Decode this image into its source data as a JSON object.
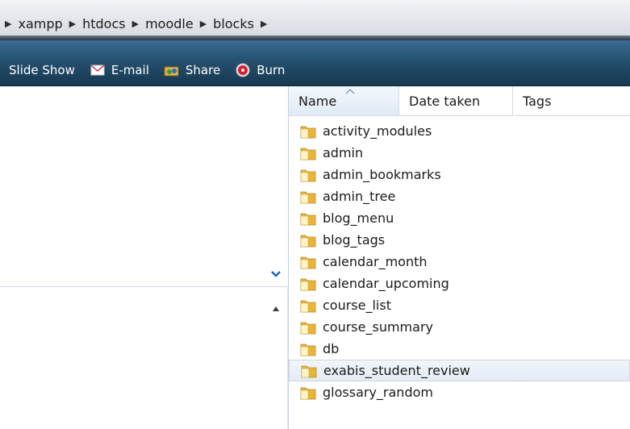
{
  "breadcrumb": {
    "items": [
      "xampp",
      "htdocs",
      "moodle",
      "blocks"
    ],
    "separator_glyph": "▶"
  },
  "toolbar": {
    "items": [
      {
        "label": "Slide Show",
        "icon": "none"
      },
      {
        "label": "E-mail",
        "icon": "email-icon"
      },
      {
        "label": "Share",
        "icon": "share-icon"
      },
      {
        "label": "Burn",
        "icon": "burn-icon"
      }
    ]
  },
  "file_list": {
    "columns": [
      "Name",
      "Date taken",
      "Tags"
    ],
    "sorted_column": "Name",
    "folders": [
      "activity_modules",
      "admin",
      "admin_bookmarks",
      "admin_tree",
      "blog_menu",
      "blog_tags",
      "calendar_month",
      "calendar_upcoming",
      "course_list",
      "course_summary",
      "db",
      "exabis_student_review",
      "glossary_random"
    ],
    "selected_folder": "exabis_student_review"
  },
  "colors": {
    "toolbar_bg": "#25506f",
    "folder_yellow": "#f3c74a",
    "selection_border": "#cdd6e1"
  }
}
